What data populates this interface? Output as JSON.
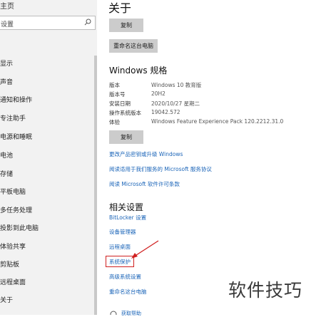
{
  "sidebar": {
    "top_label": "主页",
    "search_placeholder": "设置",
    "items": [
      {
        "label": "显示"
      },
      {
        "label": "声音"
      },
      {
        "label": "通知和操作"
      },
      {
        "label": "专注助手"
      },
      {
        "label": "电源和睡眠"
      },
      {
        "label": "电池"
      },
      {
        "label": "存储"
      },
      {
        "label": "平板电脑"
      },
      {
        "label": "多任务处理"
      },
      {
        "label": "投影到此电脑"
      },
      {
        "label": "体验共享"
      },
      {
        "label": "剪贴板"
      },
      {
        "label": "远程桌面"
      },
      {
        "label": "关于"
      }
    ]
  },
  "main": {
    "title": "关于",
    "copy_button": "复制",
    "rename_button": "重命名这台电脑",
    "windows_spec": {
      "heading": "Windows 规格",
      "rows": [
        {
          "key": "版本",
          "value": "Windows 10 教育版"
        },
        {
          "key": "版本号",
          "value": "20H2"
        },
        {
          "key": "安装日期",
          "value": "2020/10/27 星期二"
        },
        {
          "key": "操作系统版本",
          "value": "19042.572"
        },
        {
          "key": "体验",
          "value": "Windows Feature Experience Pack 120.2212.31.0"
        }
      ],
      "copy_button": "复制",
      "links": [
        "更改产品密钥或升级 Windows",
        "阅读适用于我们服务的 Microsoft 服务协议",
        "阅读 Microsoft 软件许可条款"
      ]
    },
    "related": {
      "heading": "相关设置",
      "links": [
        "BitLocker 设置",
        "设备管理器",
        "远程桌面",
        "系统保护",
        "高级系统设置",
        "重命名这台电脑"
      ],
      "bottom_link": "获取帮助"
    },
    "accent_color": "#1a64b8",
    "highlight_color": "#d02020"
  },
  "watermark": "软件技巧"
}
